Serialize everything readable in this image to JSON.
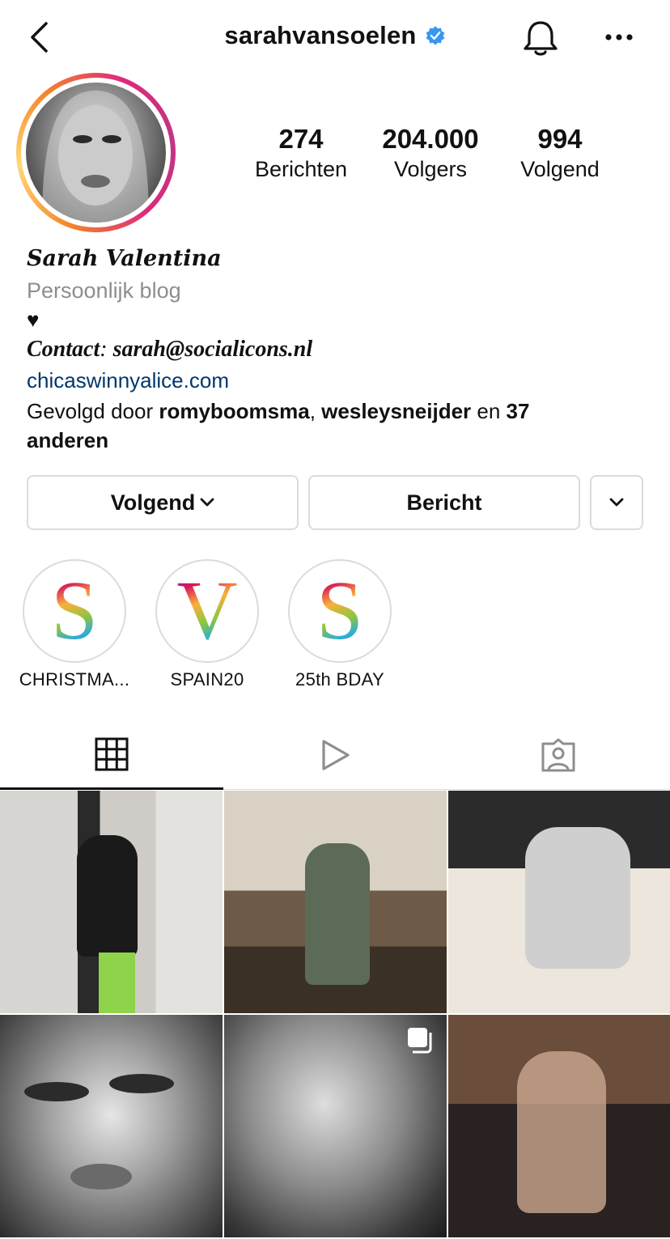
{
  "header": {
    "username": "sarahvansoelen",
    "back_icon": "chevron-left-icon",
    "verified_icon": "verified-badge-icon",
    "bell_icon": "bell-icon",
    "more_icon": "more-horizontal-icon"
  },
  "stats": [
    {
      "value": "274",
      "label": "Berichten"
    },
    {
      "value": "204.000",
      "label": "Volgers"
    },
    {
      "value": "994",
      "label": "Volgend"
    }
  ],
  "bio": {
    "full_name": "Sarah Valentina",
    "category": "Persoonlijk blog",
    "heart": "♥",
    "contact_label": "Contact",
    "contact_sep": ": ",
    "contact_value": "sarah@socialicons.nl",
    "link": "chicaswinnyalice.com",
    "followed_prefix": "Gevolgd door ",
    "followed_user1": "romyboomsma",
    "followed_sep": ", ",
    "followed_user2": "wesleysneijder",
    "followed_and": " en ",
    "followed_count": "37",
    "followed_suffix": "anderen"
  },
  "buttons": {
    "following": "Volgend",
    "message": "Bericht"
  },
  "highlights": [
    {
      "letter": "S",
      "label": "CHRISTMA..."
    },
    {
      "letter": "V",
      "label": "SPAIN20"
    },
    {
      "letter": "S",
      "label": "25th BDAY"
    }
  ],
  "tabs": [
    "grid-icon",
    "reels-play-icon",
    "tagged-icon"
  ],
  "colors": {
    "link": "#00376b",
    "verified": "#3897f0",
    "muted": "#8e8e8e",
    "border": "#dbdbdb"
  }
}
